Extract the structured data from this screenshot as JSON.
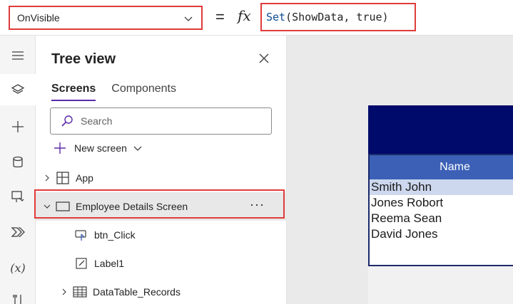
{
  "formula_bar": {
    "property": "OnVisible",
    "fx": "fx",
    "equals": "=",
    "formula_fn": "Set",
    "formula_rest": "(ShowData, true)"
  },
  "rail": {
    "items": [
      "menu-icon",
      "layers-icon",
      "plus-icon",
      "data-icon",
      "media-icon",
      "power-automate-icon",
      "variables-icon",
      "tools-icon"
    ],
    "variables_label": "(x)"
  },
  "tree": {
    "title": "Tree view",
    "tabs": [
      {
        "label": "Screens",
        "active": true
      },
      {
        "label": "Components",
        "active": false
      }
    ],
    "search_placeholder": "Search",
    "new_screen": "New screen",
    "items": [
      {
        "label": "App"
      },
      {
        "label": "Employee Details Screen",
        "more": "···"
      },
      {
        "label": "btn_Click"
      },
      {
        "label": "Label1"
      },
      {
        "label": "DataTable_Records"
      }
    ]
  },
  "canvas": {
    "table": {
      "column": "Name",
      "rows": [
        "Smith John",
        "Jones Robort",
        "Reema Sean",
        "David Jones"
      ]
    }
  },
  "colors": {
    "accent": "#5a2ba8",
    "highlight": "#e03b3b",
    "header": "#000a6b",
    "table_head": "#3b60b6"
  }
}
